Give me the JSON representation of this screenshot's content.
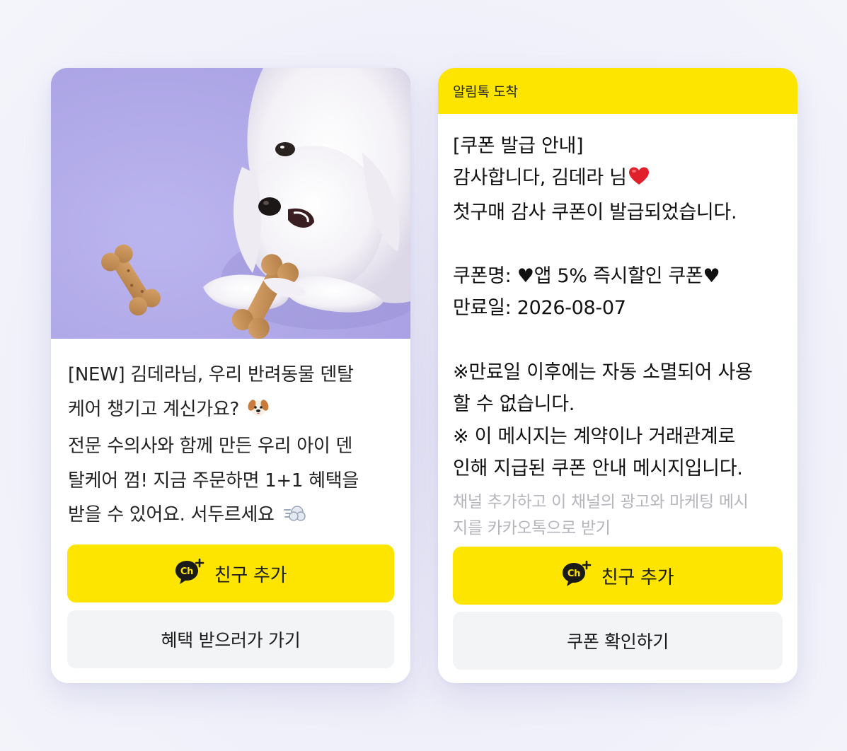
{
  "left_card": {
    "photo_icon": "puppy-with-dog-biscuit-photo",
    "message_lines": [
      "[NEW] 김데라님, 우리 반려동물 덴탈",
      "케어 챙기고 계신가요? ",
      "전문 수의사와 함께 만든 우리 아이 덴",
      "탈케어 껌! 지금 주문하면 1+1 혜택을",
      "받을 수 있어요. 서두르세요 "
    ],
    "add_friend_label": "친구 추가",
    "benefit_label": "혜택 받으러가 가기"
  },
  "right_card": {
    "header_title": "알림톡 도착",
    "message_text": "[쿠폰 발급 안내]\n감사합니다, 김데라 님",
    "message_body": "첫구매 감사 쿠폰이 발급되었습니다.\n\n쿠폰명: ♥앱 5% 즉시할인 쿠폰♥\n만료일: 2026-08-07\n\n※만료일 이후에는 자동 소멸되어 사용\n할 수 없습니다.\n※ 이 메시지는 계약이나 거래관계로\n인해 지급된 쿠폰 안내 메시지입니다.",
    "marketing_text": "채널 추가하고 이 채널의 광고와 마케팅 메시\n지를 카카오톡으로 받기",
    "add_friend_label": "친구 추가",
    "coupon_label": "쿠폰 확인하기"
  },
  "colors": {
    "kakao_yellow": "#fee500",
    "button_gray": "#f3f4f6",
    "photo_bg": "#b3acea"
  },
  "icons": [
    "kakao-channel-icon",
    "dog-face-emoji",
    "dash-emoji",
    "red-heart-emoji"
  ]
}
